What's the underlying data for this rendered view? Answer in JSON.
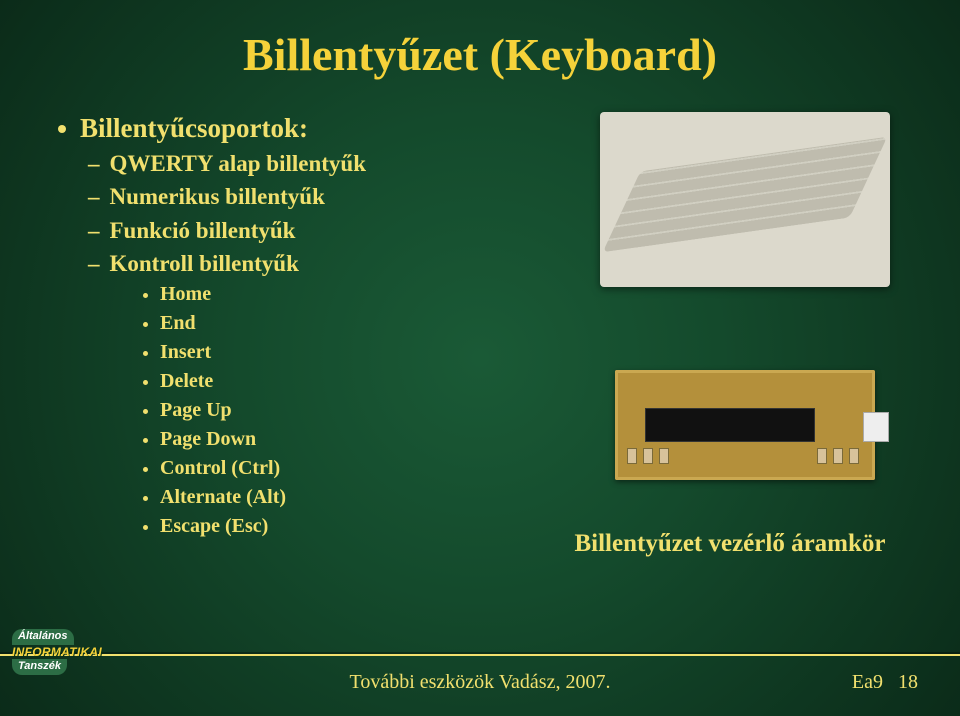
{
  "title": "Billentyűzet (Keyboard)",
  "bullets": {
    "lvl1": "Billentyűcsoportok:",
    "lvl2": [
      "QWERTY alap billentyűk",
      "Numerikus billentyűk",
      "Funkció billentyűk",
      "Kontroll billentyűk"
    ],
    "lvl3": [
      "Home",
      "End",
      "Insert",
      "Delete",
      "Page Up",
      "Page Down",
      "Control (Ctrl)",
      "Alternate (Alt)",
      "Escape (Esc)"
    ]
  },
  "caption": "Billentyűzet vezérlő áramkör",
  "footer": "További eszközök Vadász, 2007.",
  "page_label": "Ea9",
  "page_number": "18",
  "logo": {
    "line1": "Általános",
    "line2": "INFORMATIKAI",
    "line3": "Tanszék"
  }
}
